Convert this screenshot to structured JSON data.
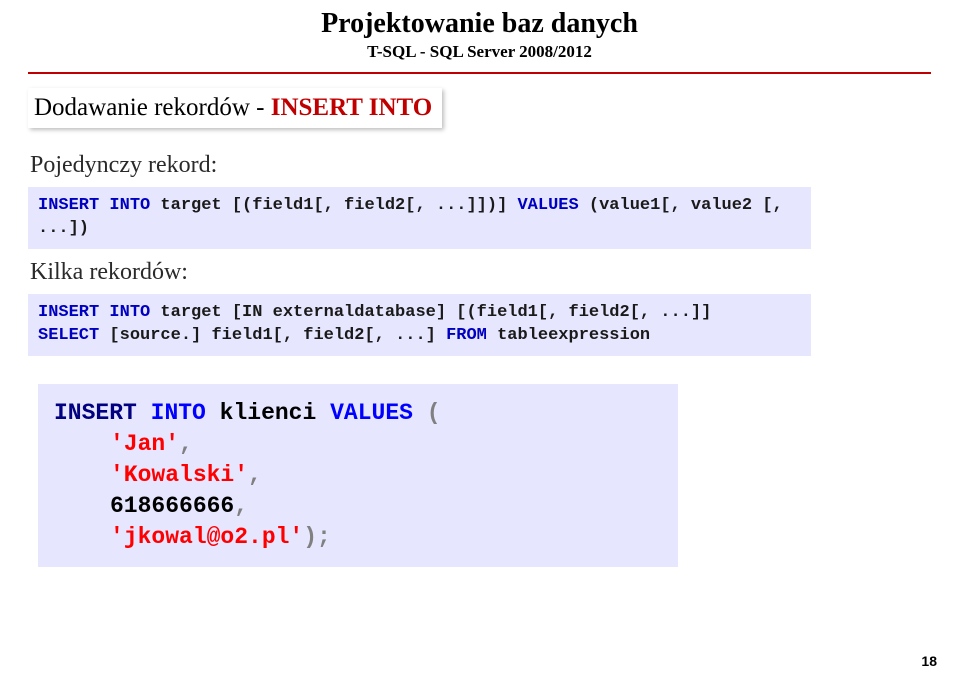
{
  "header": {
    "title": "Projektowanie baz danych",
    "subtitle": "T-SQL - SQL Server 2008/2012"
  },
  "section": {
    "prefix": "Dodawanie rekordów - ",
    "highlight": "INSERT INTO"
  },
  "body": {
    "label1": "Pojedynczy rekord:",
    "label2": "Kilka rekordów:"
  },
  "code1": {
    "kw1": "INSERT INTO ",
    "rest1": "target [(field1[, field2[, ...]])] ",
    "kw2": "VALUES ",
    "rest2": "(value1[, value2 [, ...])"
  },
  "code2": {
    "kw1": "INSERT INTO ",
    "rest1": "target [IN externaldatabase] [(field1[, field2[, ...]]",
    "kw2": "SELECT ",
    "rest2": "[source.] field1[, field2[, ...] ",
    "kw3": "FROM",
    "rest3": " tableexpression"
  },
  "example": {
    "kw_insert": "INSERT",
    "kw_into": "INTO",
    "ident": "klienci",
    "kw_values": "VALUES",
    "paren_open": "(",
    "str1": "'Jan'",
    "comma": ",",
    "str2": "'Kowalski'",
    "num": "618666666",
    "str3": "'jkowal@o2.pl'",
    "paren_close_semi": ");"
  },
  "page_number": "18"
}
